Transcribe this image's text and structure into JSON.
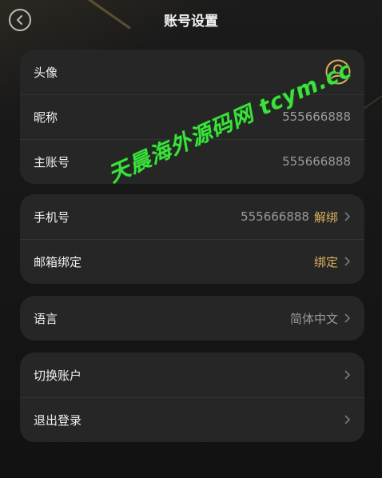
{
  "header": {
    "title": "账号设置"
  },
  "icons": {
    "back": "back-arrow-icon",
    "avatar": "user-avatar-icon",
    "chevron": "chevron-right-icon"
  },
  "colors": {
    "accent": "#d9b15d",
    "background": "#141414",
    "card": "#262626",
    "watermark": "#3ee03e"
  },
  "profile": {
    "avatar_label": "头像",
    "nickname_label": "昵称",
    "nickname_value": "555666888",
    "account_label": "主账号",
    "account_value": "555666888"
  },
  "binding": {
    "phone_label": "手机号",
    "phone_value": "555666888",
    "phone_action": "解绑",
    "email_label": "邮箱绑定",
    "email_action": "绑定"
  },
  "language": {
    "label": "语言",
    "value": "简体中文"
  },
  "session": {
    "switch_label": "切换账户",
    "logout_label": "退出登录"
  },
  "watermark": "天晨海外源码网 tcym.cc"
}
